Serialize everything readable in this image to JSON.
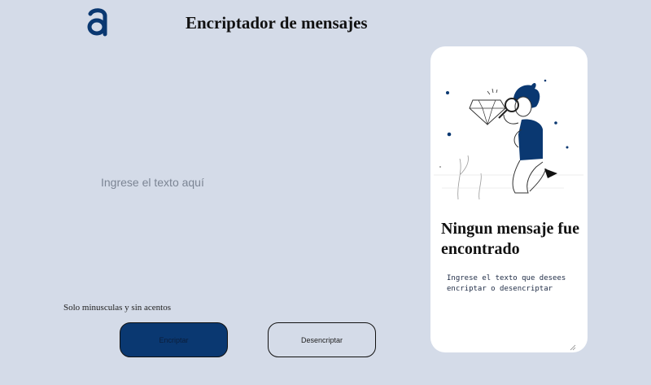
{
  "header": {
    "logo_icon": "alura-a-logo-icon",
    "title": "Encriptador de mensajes"
  },
  "main": {
    "input": {
      "placeholder": "Ingrese el texto aquí",
      "value": ""
    },
    "hint": "Solo minusculas y sin acentos",
    "buttons": {
      "encrypt_label": "Encriptar",
      "decrypt_label": "Desencriptar"
    }
  },
  "panel": {
    "illustration_icon": "person-with-magnifying-glass-illustration",
    "title": "Ningun mensaje fue encontrado",
    "description": "Ingrese el texto que desees encriptar o desencriptar"
  },
  "colors": {
    "background": "#d4dbe8",
    "accent": "#0a3871",
    "panel": "#ffffff"
  }
}
